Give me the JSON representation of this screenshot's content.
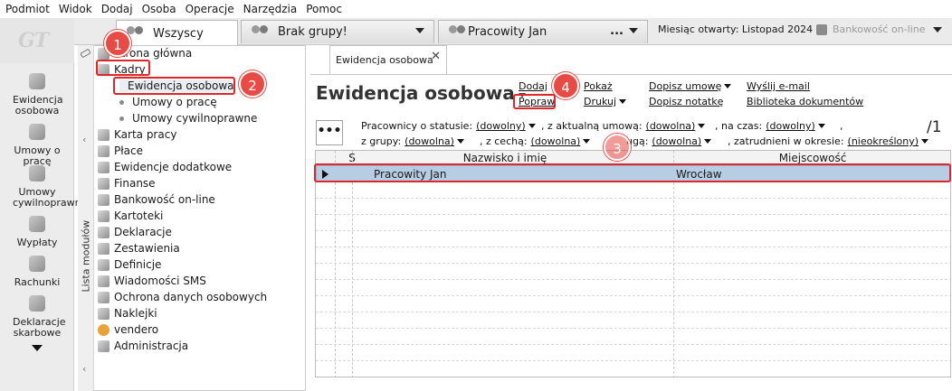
{
  "menubar": {
    "items": [
      "Podmiot",
      "Widok",
      "Dodaj",
      "Osoba",
      "Operacje",
      "Narzędzia",
      "Pomoc"
    ]
  },
  "logo": {
    "text": "GT"
  },
  "group_tabs": [
    {
      "label": "Wszyscy",
      "active": true
    },
    {
      "label": "Brak grupy!",
      "active": false
    },
    {
      "label": "Pracowity Jan",
      "active": false,
      "extra": "..."
    }
  ],
  "header": {
    "month_label": "Miesiąc otwarty:",
    "month_value": "Listopad 2024 r.",
    "bank_label": "Bankowość on-line"
  },
  "leftbar": {
    "items": [
      {
        "label": "Ewidencja osobowa",
        "icon": "people-icon"
      },
      {
        "label": "Umowy o pracę",
        "icon": "contract-icon"
      },
      {
        "label": "Umowy cywilnoprawne",
        "icon": "contract-civil-icon"
      },
      {
        "label": "Wypłaty",
        "icon": "payment-icon"
      },
      {
        "label": "Rachunki",
        "icon": "invoice-icon"
      },
      {
        "label": "Deklaracje skarbowe",
        "icon": "tax-icon"
      }
    ]
  },
  "modules": {
    "vertical_label": "Lista modułów",
    "items": [
      {
        "label": "Strona główna",
        "icon": "home-icon"
      },
      {
        "label": "Kadry",
        "icon": "hr-icon"
      },
      {
        "label": "Ewidencja osobowa",
        "sub": true,
        "selected": true
      },
      {
        "label": "Umowy o pracę",
        "sub": true
      },
      {
        "label": "Umowy cywilnoprawne",
        "sub": true
      },
      {
        "label": "Karta pracy",
        "icon": "card-icon"
      },
      {
        "label": "Płace",
        "icon": "pay-icon"
      },
      {
        "label": "Ewidencje dodatkowe",
        "icon": "records-icon"
      },
      {
        "label": "Finanse",
        "icon": "finance-icon"
      },
      {
        "label": "Bankowość on-line",
        "icon": "bank-icon"
      },
      {
        "label": "Kartoteki",
        "icon": "files-icon"
      },
      {
        "label": "Deklaracje",
        "icon": "declaration-icon"
      },
      {
        "label": "Zestawienia",
        "icon": "report-icon"
      },
      {
        "label": "Definicje",
        "icon": "definitions-icon"
      },
      {
        "label": "Wiadomości SMS",
        "icon": "sms-icon"
      },
      {
        "label": "Ochrona danych osobowych",
        "icon": "privacy-icon"
      },
      {
        "label": "Naklejki",
        "icon": "label-icon"
      },
      {
        "label": "vendero",
        "icon": "vendero-icon"
      },
      {
        "label": "Administracja",
        "icon": "admin-icon"
      }
    ]
  },
  "doc": {
    "tab_label": "Ewidencja osobowa",
    "title": "Ewidencja osobowa",
    "actions": {
      "dodaj": "Dodaj",
      "popraw": "Popraw",
      "pokaz": "Pokaż",
      "drukuj": "Drukuj",
      "dopisz_umowe": "Dopisz umowę",
      "dopisz_notatke": "Dopisz notatkę",
      "wyslij_email": "Wyślij e-mail",
      "biblioteka": "Biblioteka dokumentów"
    },
    "more_button": "•••",
    "filters": {
      "status_label": "Pracownicy o statusie:",
      "status_value": "(dowolny)",
      "umowa_label": ", z aktualną umową:",
      "umowa_value": "(dowolna)",
      "czas_label": ", na czas:",
      "czas_value": "(dowolny)",
      "comma": ",",
      "grupa_label": "z grupy:",
      "grupa_value": "(dowolna)",
      "cecha_label": ", z cechą:",
      "cecha_value": "(dowolna)",
      "uga_label": "ugą:",
      "uga_value": "(dowolna)",
      "okres_label": ", zatrudnieni w okresie:",
      "okres_value": "(nieokreślony)"
    },
    "page_count": "/1",
    "table": {
      "headers": [
        "S",
        "Nazwisko i imię",
        "Miejscowość"
      ],
      "rows": [
        {
          "s": "",
          "name": "Pracowity Jan",
          "city": "Wrocław",
          "selected": true
        }
      ]
    }
  },
  "callouts": [
    "1",
    "2",
    "3",
    "4"
  ],
  "colors": {
    "highlight": "#e1262b",
    "badge": "#e84a45",
    "selected_row": "#b7cde3"
  }
}
